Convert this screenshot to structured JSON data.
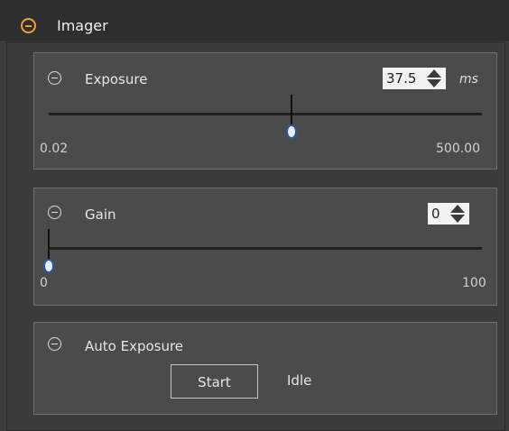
{
  "header": {
    "title": "Imager",
    "icon": "collapse-minus-icon"
  },
  "exposure": {
    "title": "Exposure",
    "value": "37.5",
    "unit": "ms",
    "min_label": "0.02",
    "max_label": "500.00",
    "slider_fraction": 0.56
  },
  "gain": {
    "title": "Gain",
    "value": "0",
    "min_label": "0",
    "max_label": "100",
    "slider_fraction": 0.0
  },
  "auto_exposure": {
    "title": "Auto Exposure",
    "start_label": "Start",
    "status": "Idle"
  },
  "colors": {
    "accent": "#f0a030",
    "panel": "#4b4b4b",
    "background": "#3b3b3b",
    "handle": "#2c5a9a"
  }
}
